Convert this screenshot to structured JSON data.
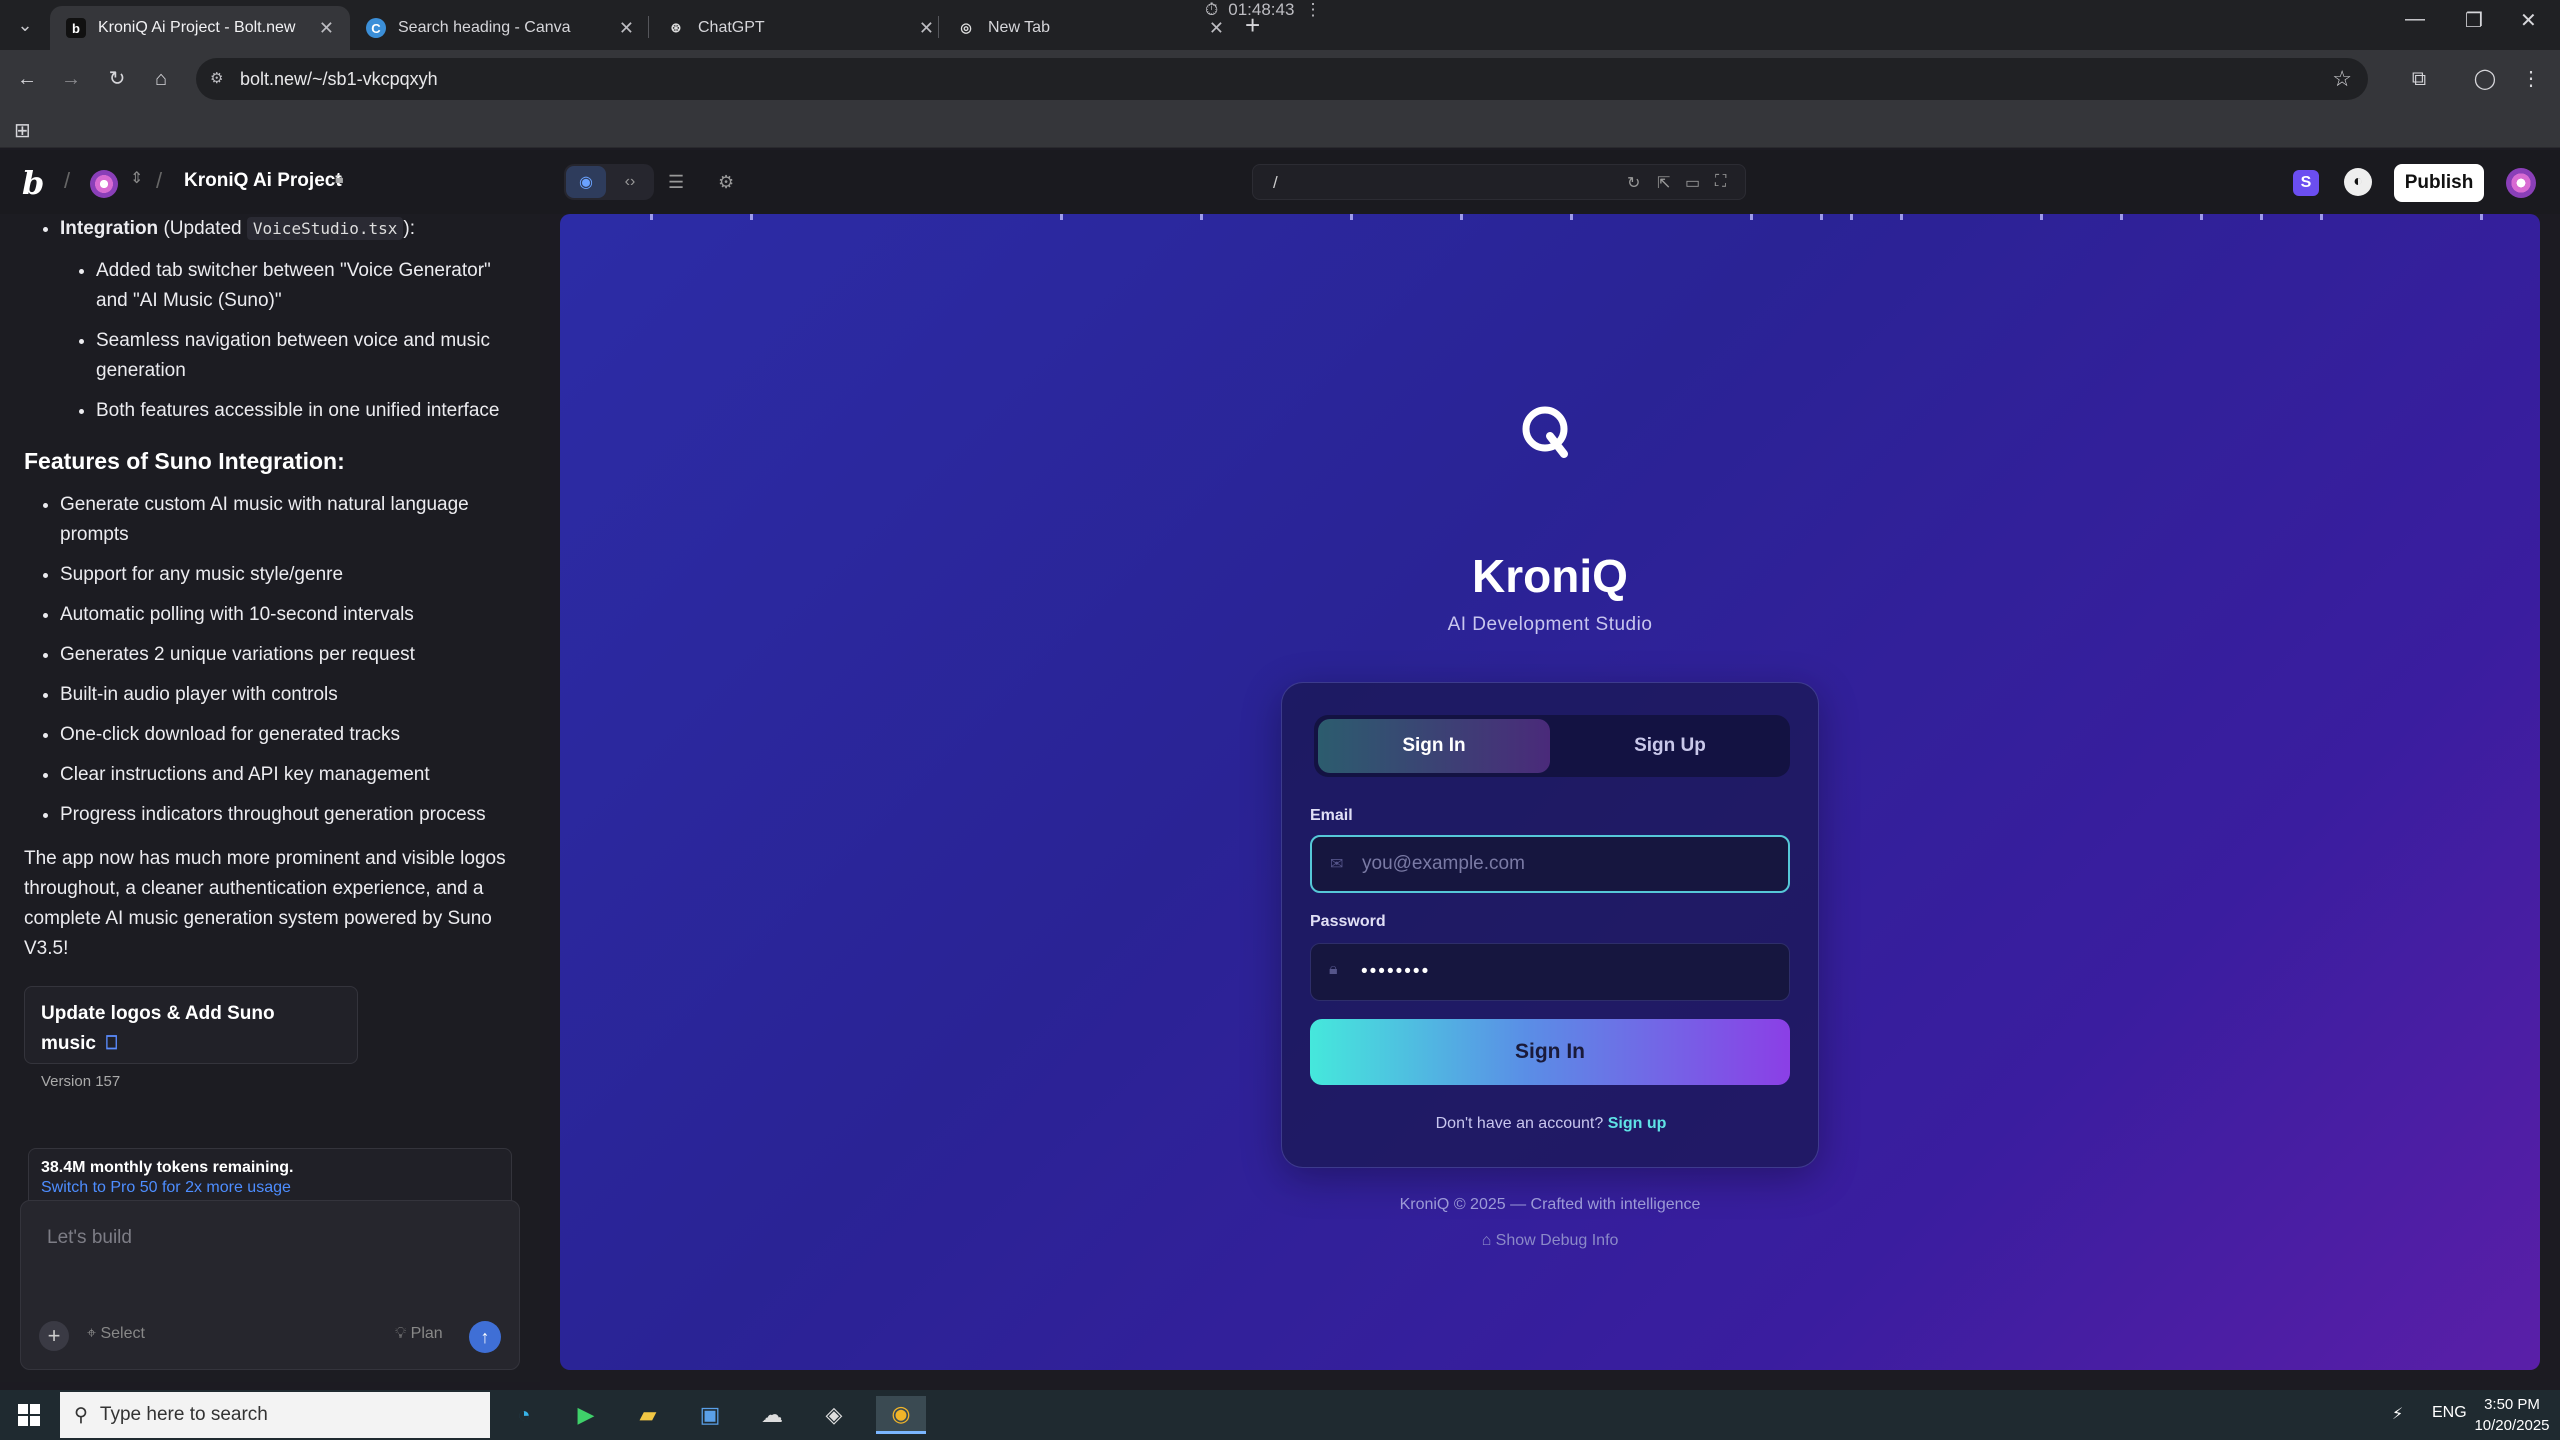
{
  "browser": {
    "tabs": [
      {
        "title": "KroniQ Ai Project - Bolt.new",
        "favicon": "b",
        "active": true
      },
      {
        "title": "Search heading - Canva",
        "favicon": "C",
        "active": false
      },
      {
        "title": "ChatGPT",
        "favicon": "⊛",
        "active": false
      },
      {
        "title": "New Tab",
        "favicon": "◎",
        "active": false
      }
    ],
    "timer": "01:48:43",
    "url": "bolt.new/~/sb1-vkcpqxyh"
  },
  "bolt": {
    "project_name": "KroniQ Ai Project",
    "preview_path": "/",
    "publish_label": "Publish",
    "s_badge": "S"
  },
  "chat": {
    "integration_label": "Integration",
    "integration_suffix": " (Updated ",
    "integration_file": "VoiceStudio.tsx",
    "integration_end": "):",
    "integration_items": [
      "Added tab switcher between \"Voice Generator\" and \"AI Music (Suno)\"",
      "Seamless navigation between voice and music generation",
      "Both features accessible in one unified interface"
    ],
    "features_heading": "Features of Suno Integration:",
    "features": [
      "Generate custom AI music with natural language prompts",
      "Support for any music style/genre",
      "Automatic polling with 10-second intervals",
      "Generates 2 unique variations per request",
      "Built-in audio player with controls",
      "One-click download for generated tracks",
      "Clear instructions and API key management",
      "Progress indicators throughout generation process"
    ],
    "summary": "The app now has much more prominent and visible logos throughout, a cleaner authentication experience, and a complete AI music generation system powered by Suno V3.5!",
    "version_card": {
      "title": "Update logos & Add Suno music",
      "version": "Version 157"
    },
    "tokens": {
      "remaining": "38.4M monthly tokens remaining.",
      "upgrade": "Switch to Pro 50 for 2x more usage"
    },
    "composer": {
      "placeholder": "Let's build",
      "select_label": "Select",
      "plan_label": "Plan"
    }
  },
  "preview": {
    "brand_name": "KroniQ",
    "brand_sub": "AI Development Studio",
    "tabs": {
      "sign_in": "Sign In",
      "sign_up": "Sign Up"
    },
    "email_label": "Email",
    "email_placeholder": "you@example.com",
    "password_label": "Password",
    "password_value": "••••••••",
    "submit_label": "Sign In",
    "switch_prompt": "Don't have an account?",
    "switch_link": "Sign up",
    "footer": "KroniQ © 2025 — Crafted with intelligence",
    "debug_link": "Show Debug Info"
  },
  "taskbar": {
    "search_placeholder": "Type here to search",
    "language": "ENG",
    "time": "3:50 PM",
    "date": "10/20/2025"
  },
  "colors": {
    "preview_gradient_start": "#2c2ca6",
    "preview_gradient_end": "#5a1fa8",
    "accent_cyan": "#45e8dc",
    "accent_purple": "#8b3fe6"
  }
}
